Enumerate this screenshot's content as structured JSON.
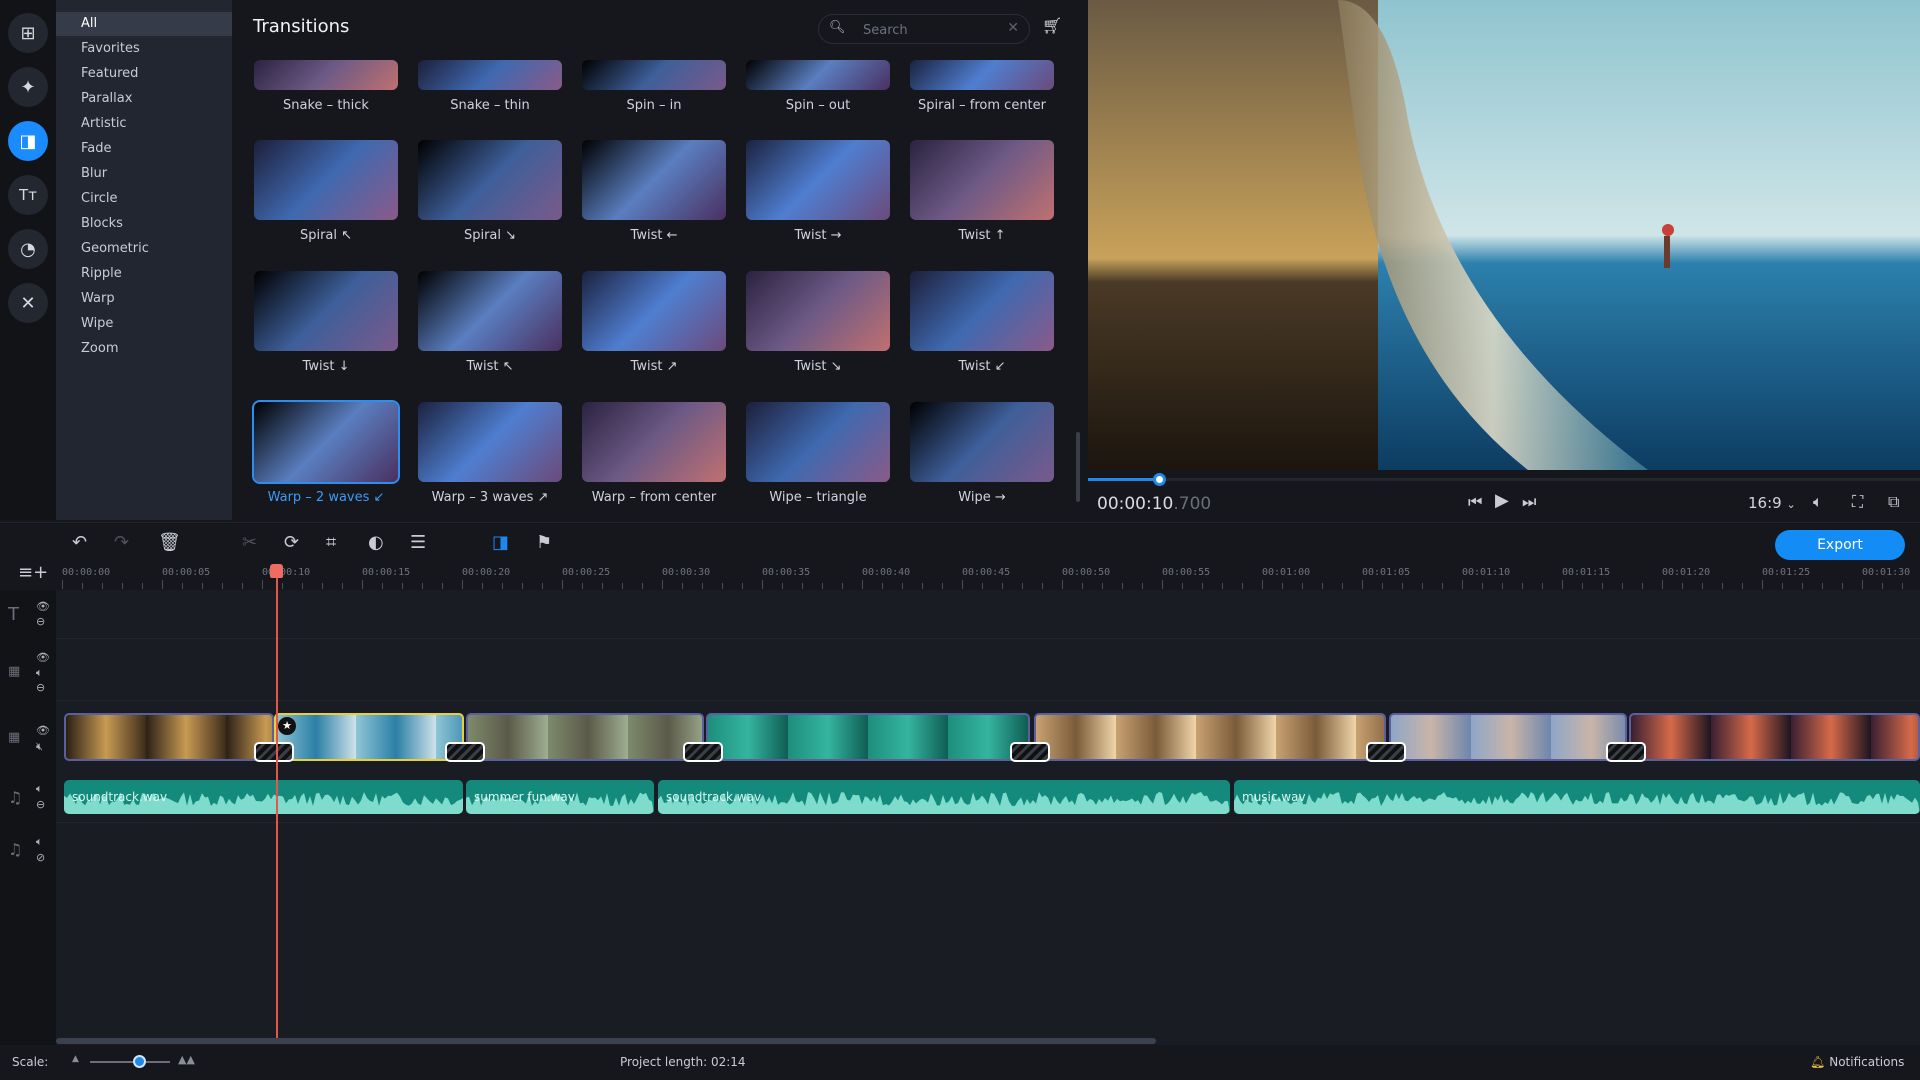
{
  "rail": [
    {
      "name": "import-icon",
      "glyph": "⊞"
    },
    {
      "name": "magic-wand-icon",
      "glyph": "✦"
    },
    {
      "name": "transitions-icon",
      "glyph": "◨",
      "active": true
    },
    {
      "name": "titles-icon",
      "glyph": "Tт"
    },
    {
      "name": "stickers-icon",
      "glyph": "◔"
    },
    {
      "name": "tools-icon",
      "glyph": "✕"
    }
  ],
  "categories": [
    "All",
    "Favorites",
    "Featured",
    "Parallax",
    "Artistic",
    "Fade",
    "Blur",
    "Circle",
    "Blocks",
    "Geometric",
    "Ripple",
    "Warp",
    "Wipe",
    "Zoom"
  ],
  "active_category": "All",
  "transitions": {
    "title": "Transitions",
    "search_placeholder": "Search",
    "tiles": [
      {
        "label": "Snake – thick"
      },
      {
        "label": "Snake – thin"
      },
      {
        "label": "Spin – in"
      },
      {
        "label": "Spin – out"
      },
      {
        "label": "Spiral – from center"
      },
      {
        "label": "Spiral ↖"
      },
      {
        "label": "Spiral ↘"
      },
      {
        "label": "Twist ←"
      },
      {
        "label": "Twist →"
      },
      {
        "label": "Twist ↑"
      },
      {
        "label": "Twist ↓"
      },
      {
        "label": "Twist ↖"
      },
      {
        "label": "Twist ↗"
      },
      {
        "label": "Twist ↘"
      },
      {
        "label": "Twist ↙"
      },
      {
        "label": "Warp – 2 waves ↙",
        "selected": true
      },
      {
        "label": "Warp – 3 waves ↗"
      },
      {
        "label": "Warp – from center"
      },
      {
        "label": "Wipe – triangle"
      },
      {
        "label": "Wipe →"
      }
    ]
  },
  "player": {
    "timecode_main": "00:00:10",
    "timecode_ms": ".700",
    "progress_fraction": 0.08,
    "aspect_ratio": "16:9"
  },
  "toolbar": {
    "export_label": "Export"
  },
  "ruler": [
    "00:00:00",
    "00:00:05",
    "00:00:10",
    "00:00:15",
    "00:00:20",
    "00:00:25",
    "00:00:30",
    "00:00:35",
    "00:00:40",
    "00:00:45",
    "00:00:50",
    "00:00:55",
    "00:01:00",
    "00:01:05",
    "00:01:10",
    "00:01:15",
    "00:01:20",
    "00:01:25",
    "00:01:30"
  ],
  "video_clips": [
    {
      "name": "sailboat-clip",
      "colors": [
        "#2a2016",
        "#c89a52",
        "#3d2c1a"
      ]
    },
    {
      "name": "kitesurf-clip",
      "colors": [
        "#8fc6d6",
        "#2b7fa6",
        "#cfe3ea"
      ],
      "selected": true
    },
    {
      "name": "elephants-clip",
      "colors": [
        "#7d8a6a",
        "#5b5a4a",
        "#9fae90"
      ]
    },
    {
      "name": "reef-clip",
      "colors": [
        "#1d8f7c",
        "#34b59f",
        "#0f5d52"
      ]
    },
    {
      "name": "friends-clip",
      "colors": [
        "#c9a272",
        "#7a5b3a",
        "#f1d6a9"
      ]
    },
    {
      "name": "girl-clip",
      "colors": [
        "#8fa6c8",
        "#c9b5a8",
        "#6e86ad"
      ]
    },
    {
      "name": "sunset-clip",
      "colors": [
        "#3a2030",
        "#d66a4a",
        "#1c1420"
      ]
    }
  ],
  "audio_clips": [
    {
      "label": "soundtrack.wav"
    },
    {
      "label": "summer fun.wav"
    },
    {
      "label": "soundtrack.wav"
    },
    {
      "label": "music.wav"
    }
  ],
  "status": {
    "scale_label": "Scale:",
    "project_length": "Project length:  02:14",
    "notifications": "Notifications"
  }
}
